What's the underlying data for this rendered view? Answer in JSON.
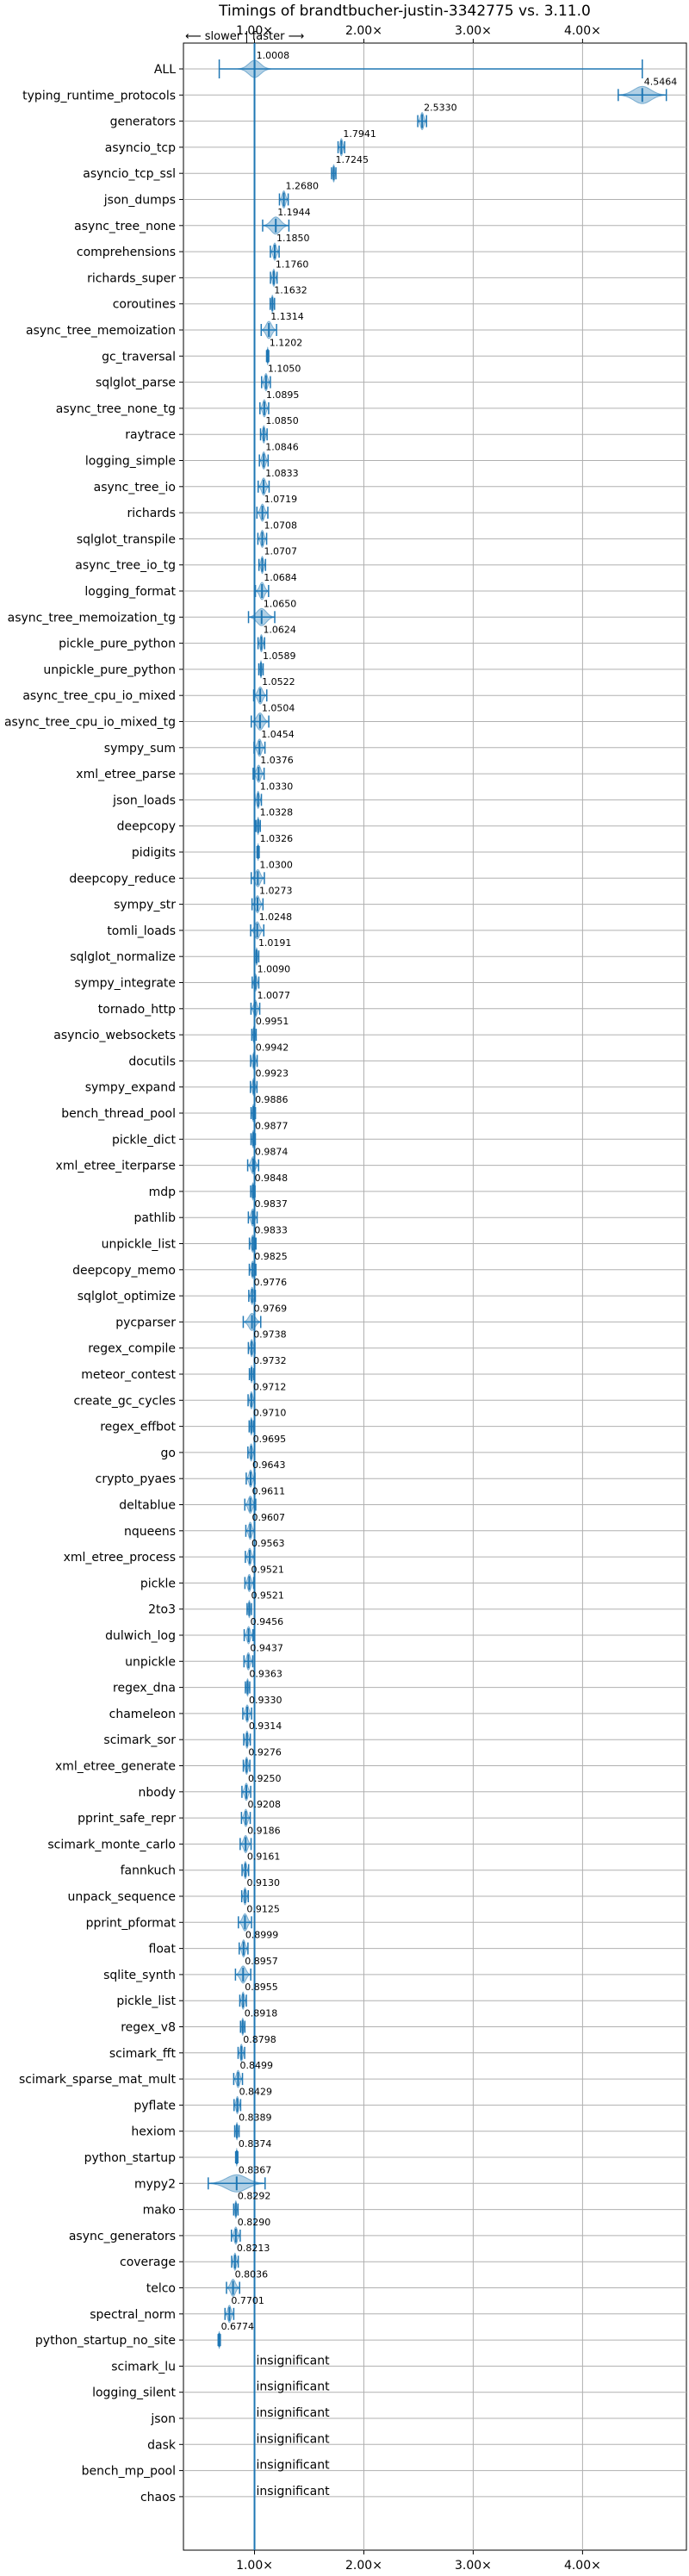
{
  "chart_data": {
    "type": "violin",
    "title": "Timings of brandtbucher-justin-3342775 vs. 3.11.0",
    "direction_note": "⟵ slower   |   faster ⟶",
    "xlim": [
      0.35,
      4.95
    ],
    "reference_line": 1.0,
    "x_ticks": [
      {
        "value": 1.0,
        "label": "1.00×"
      },
      {
        "value": 2.0,
        "label": "2.00×"
      },
      {
        "value": 3.0,
        "label": "3.00×"
      },
      {
        "value": 4.0,
        "label": "4.00×"
      }
    ],
    "grid": true,
    "color": "#1f77b4",
    "insignificant_text": "insignificant",
    "benchmarks": [
      {
        "name": "ALL",
        "value": 1.0008,
        "label": "1.0008",
        "min": 0.6774,
        "max": 4.5464,
        "spread": 0.15
      },
      {
        "name": "typing_runtime_protocols",
        "value": 4.5464,
        "label": "4.5464",
        "spread": 0.22
      },
      {
        "name": "generators",
        "value": 2.533,
        "label": "2.5330",
        "spread": 0.04
      },
      {
        "name": "asyncio_tcp",
        "value": 1.7941,
        "label": "1.7941",
        "spread": 0.03
      },
      {
        "name": "asyncio_tcp_ssl",
        "value": 1.7245,
        "label": "1.7245",
        "spread": 0.02
      },
      {
        "name": "json_dumps",
        "value": 1.268,
        "label": "1.2680",
        "spread": 0.04
      },
      {
        "name": "async_tree_none",
        "value": 1.1944,
        "label": "1.1944",
        "spread": 0.12
      },
      {
        "name": "comprehensions",
        "value": 1.185,
        "label": "1.1850",
        "spread": 0.04
      },
      {
        "name": "richards_super",
        "value": 1.176,
        "label": "1.1760",
        "spread": 0.03
      },
      {
        "name": "coroutines",
        "value": 1.1632,
        "label": "1.1632",
        "spread": 0.02
      },
      {
        "name": "async_tree_memoization",
        "value": 1.1314,
        "label": "1.1314",
        "spread": 0.07
      },
      {
        "name": "gc_traversal",
        "value": 1.1202,
        "label": "1.1202",
        "spread": 0.01
      },
      {
        "name": "sqlglot_parse",
        "value": 1.105,
        "label": "1.1050",
        "spread": 0.04
      },
      {
        "name": "async_tree_none_tg",
        "value": 1.0895,
        "label": "1.0895",
        "spread": 0.04
      },
      {
        "name": "raytrace",
        "value": 1.085,
        "label": "1.0850",
        "spread": 0.03
      },
      {
        "name": "logging_simple",
        "value": 1.0846,
        "label": "1.0846",
        "spread": 0.04
      },
      {
        "name": "async_tree_io",
        "value": 1.0833,
        "label": "1.0833",
        "spread": 0.05
      },
      {
        "name": "richards",
        "value": 1.0719,
        "label": "1.0719",
        "spread": 0.05
      },
      {
        "name": "sqlglot_transpile",
        "value": 1.0708,
        "label": "1.0708",
        "spread": 0.04
      },
      {
        "name": "async_tree_io_tg",
        "value": 1.0707,
        "label": "1.0707",
        "spread": 0.03
      },
      {
        "name": "logging_format",
        "value": 1.0684,
        "label": "1.0684",
        "spread": 0.06
      },
      {
        "name": "async_tree_memoization_tg",
        "value": 1.065,
        "label": "1.0650",
        "spread": 0.12
      },
      {
        "name": "pickle_pure_python",
        "value": 1.0624,
        "label": "1.0624",
        "spread": 0.03
      },
      {
        "name": "unpickle_pure_python",
        "value": 1.0589,
        "label": "1.0589",
        "spread": 0.02
      },
      {
        "name": "async_tree_cpu_io_mixed",
        "value": 1.0522,
        "label": "1.0522",
        "spread": 0.06
      },
      {
        "name": "async_tree_cpu_io_mixed_tg",
        "value": 1.0504,
        "label": "1.0504",
        "spread": 0.08
      },
      {
        "name": "sympy_sum",
        "value": 1.0454,
        "label": "1.0454",
        "spread": 0.05
      },
      {
        "name": "xml_etree_parse",
        "value": 1.0376,
        "label": "1.0376",
        "spread": 0.05
      },
      {
        "name": "json_loads",
        "value": 1.033,
        "label": "1.0330",
        "spread": 0.03
      },
      {
        "name": "deepcopy",
        "value": 1.0328,
        "label": "1.0328",
        "spread": 0.02
      },
      {
        "name": "pidigits",
        "value": 1.0326,
        "label": "1.0326",
        "spread": 0.01
      },
      {
        "name": "deepcopy_reduce",
        "value": 1.03,
        "label": "1.0300",
        "spread": 0.06
      },
      {
        "name": "sympy_str",
        "value": 1.0273,
        "label": "1.0273",
        "spread": 0.05
      },
      {
        "name": "tomli_loads",
        "value": 1.0248,
        "label": "1.0248",
        "spread": 0.06
      },
      {
        "name": "sqlglot_normalize",
        "value": 1.0191,
        "label": "1.0191",
        "spread": 0.02
      },
      {
        "name": "sympy_integrate",
        "value": 1.009,
        "label": "1.0090",
        "spread": 0.03
      },
      {
        "name": "tornado_http",
        "value": 1.0077,
        "label": "1.0077",
        "spread": 0.04
      },
      {
        "name": "asyncio_websockets",
        "value": 0.9951,
        "label": "0.9951",
        "spread": 0.02
      },
      {
        "name": "docutils",
        "value": 0.9942,
        "label": "0.9942",
        "spread": 0.03
      },
      {
        "name": "sympy_expand",
        "value": 0.9923,
        "label": "0.9923",
        "spread": 0.03
      },
      {
        "name": "bench_thread_pool",
        "value": 0.9886,
        "label": "0.9886",
        "spread": 0.02
      },
      {
        "name": "pickle_dict",
        "value": 0.9877,
        "label": "0.9877",
        "spread": 0.02
      },
      {
        "name": "xml_etree_iterparse",
        "value": 0.9874,
        "label": "0.9874",
        "spread": 0.05
      },
      {
        "name": "mdp",
        "value": 0.9848,
        "label": "0.9848",
        "spread": 0.02
      },
      {
        "name": "pathlib",
        "value": 0.9837,
        "label": "0.9837",
        "spread": 0.04
      },
      {
        "name": "unpickle_list",
        "value": 0.9833,
        "label": "0.9833",
        "spread": 0.03
      },
      {
        "name": "deepcopy_memo",
        "value": 0.9825,
        "label": "0.9825",
        "spread": 0.03
      },
      {
        "name": "sqlglot_optimize",
        "value": 0.9776,
        "label": "0.9776",
        "spread": 0.03
      },
      {
        "name": "pycparser",
        "value": 0.9769,
        "label": "0.9769",
        "spread": 0.08
      },
      {
        "name": "regex_compile",
        "value": 0.9738,
        "label": "0.9738",
        "spread": 0.03
      },
      {
        "name": "meteor_contest",
        "value": 0.9732,
        "label": "0.9732",
        "spread": 0.02
      },
      {
        "name": "create_gc_cycles",
        "value": 0.9712,
        "label": "0.9712",
        "spread": 0.03
      },
      {
        "name": "regex_effbot",
        "value": 0.971,
        "label": "0.9710",
        "spread": 0.02
      },
      {
        "name": "go",
        "value": 0.9695,
        "label": "0.9695",
        "spread": 0.03
      },
      {
        "name": "crypto_pyaes",
        "value": 0.9643,
        "label": "0.9643",
        "spread": 0.04
      },
      {
        "name": "deltablue",
        "value": 0.9611,
        "label": "0.9611",
        "spread": 0.05
      },
      {
        "name": "nqueens",
        "value": 0.9607,
        "label": "0.9607",
        "spread": 0.04
      },
      {
        "name": "xml_etree_process",
        "value": 0.9563,
        "label": "0.9563",
        "spread": 0.04
      },
      {
        "name": "pickle",
        "value": 0.9521,
        "label": "0.9521",
        "spread": 0.04
      },
      {
        "name": "2to3",
        "value": 0.9521,
        "label": "0.9521",
        "spread": 0.02
      },
      {
        "name": "dulwich_log",
        "value": 0.9456,
        "label": "0.9456",
        "spread": 0.04
      },
      {
        "name": "unpickle",
        "value": 0.9437,
        "label": "0.9437",
        "spread": 0.04
      },
      {
        "name": "regex_dna",
        "value": 0.9363,
        "label": "0.9363",
        "spread": 0.02
      },
      {
        "name": "chameleon",
        "value": 0.933,
        "label": "0.9330",
        "spread": 0.04
      },
      {
        "name": "scimark_sor",
        "value": 0.9314,
        "label": "0.9314",
        "spread": 0.03
      },
      {
        "name": "xml_etree_generate",
        "value": 0.9276,
        "label": "0.9276",
        "spread": 0.03
      },
      {
        "name": "nbody",
        "value": 0.925,
        "label": "0.9250",
        "spread": 0.04
      },
      {
        "name": "pprint_safe_repr",
        "value": 0.9208,
        "label": "0.9208",
        "spread": 0.04
      },
      {
        "name": "scimark_monte_carlo",
        "value": 0.9186,
        "label": "0.9186",
        "spread": 0.05
      },
      {
        "name": "fannkuch",
        "value": 0.9161,
        "label": "0.9161",
        "spread": 0.03
      },
      {
        "name": "unpack_sequence",
        "value": 0.913,
        "label": "0.9130",
        "spread": 0.03
      },
      {
        "name": "pprint_pformat",
        "value": 0.9125,
        "label": "0.9125",
        "spread": 0.06
      },
      {
        "name": "float",
        "value": 0.8999,
        "label": "0.8999",
        "spread": 0.04
      },
      {
        "name": "sqlite_synth",
        "value": 0.8957,
        "label": "0.8957",
        "spread": 0.07
      },
      {
        "name": "pickle_list",
        "value": 0.8955,
        "label": "0.8955",
        "spread": 0.03
      },
      {
        "name": "regex_v8",
        "value": 0.8918,
        "label": "0.8918",
        "spread": 0.02
      },
      {
        "name": "scimark_fft",
        "value": 0.8798,
        "label": "0.8798",
        "spread": 0.03
      },
      {
        "name": "scimark_sparse_mat_mult",
        "value": 0.8499,
        "label": "0.8499",
        "spread": 0.04
      },
      {
        "name": "pyflate",
        "value": 0.8429,
        "label": "0.8429",
        "spread": 0.03
      },
      {
        "name": "hexiom",
        "value": 0.8389,
        "label": "0.8389",
        "spread": 0.02
      },
      {
        "name": "python_startup",
        "value": 0.8374,
        "label": "0.8374",
        "spread": 0.01
      },
      {
        "name": "mypy2",
        "value": 0.8367,
        "label": "0.8367",
        "spread": 0.26
      },
      {
        "name": "mako",
        "value": 0.8292,
        "label": "0.8292",
        "spread": 0.02
      },
      {
        "name": "async_generators",
        "value": 0.829,
        "label": "0.8290",
        "spread": 0.04
      },
      {
        "name": "coverage",
        "value": 0.8213,
        "label": "0.8213",
        "spread": 0.03
      },
      {
        "name": "telco",
        "value": 0.8036,
        "label": "0.8036",
        "spread": 0.06
      },
      {
        "name": "spectral_norm",
        "value": 0.7701,
        "label": "0.7701",
        "spread": 0.04
      },
      {
        "name": "python_startup_no_site",
        "value": 0.6774,
        "label": "0.6774",
        "spread": 0.01
      },
      {
        "name": "scimark_lu",
        "insignificant": true
      },
      {
        "name": "logging_silent",
        "insignificant": true
      },
      {
        "name": "json",
        "insignificant": true
      },
      {
        "name": "dask",
        "insignificant": true
      },
      {
        "name": "bench_mp_pool",
        "insignificant": true
      },
      {
        "name": "chaos",
        "insignificant": true
      }
    ]
  }
}
